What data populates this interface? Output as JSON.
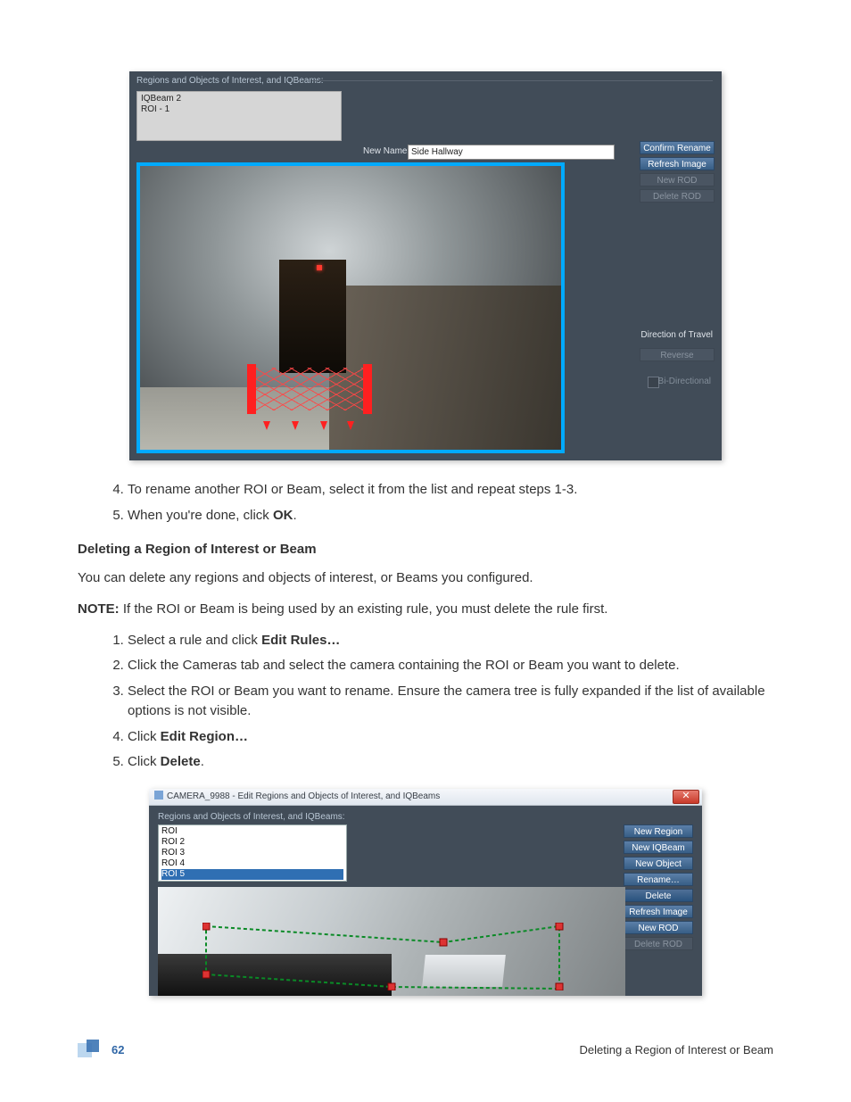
{
  "shot1": {
    "group_label": "Regions and Objects of Interest, and IQBeams:",
    "list_items": [
      "IQBeam 2",
      "ROI - 1"
    ],
    "new_name_label": "New Name:",
    "new_name_value": "Side Hallway",
    "buttons": {
      "confirm_rename": "Confirm Rename",
      "refresh_image": "Refresh Image",
      "new_rod": "New ROD",
      "delete_rod": "Delete ROD",
      "direction_label": "Direction of Travel",
      "reverse": "Reverse",
      "bidir_label": "Bi-Directional"
    }
  },
  "steps_top": {
    "s4_a": "To rename another ROI or Beam, select it from the list and repeat steps 1-3.",
    "s5_a": "When you're done, click ",
    "s5_b": "OK",
    "s5_c": "."
  },
  "heading": "Deleting a Region of Interest or Beam",
  "para1": "You can delete any regions and objects of interest, or Beams you configured.",
  "note_label": "NOTE:",
  "note_body": " If the ROI or Beam is being used by an existing rule, you must delete the rule first.",
  "steps_bottom": {
    "s1_a": "Select a rule and click ",
    "s1_b": "Edit Rules…",
    "s2": "Click the Cameras tab and select the camera containing the ROI or Beam you want to delete.",
    "s3": "Select the ROI or Beam you want to rename. Ensure the camera tree is fully expanded if the list of available options is not visible.",
    "s4_a": "Click ",
    "s4_b": "Edit Region…",
    "s5_a": "Click ",
    "s5_b": "Delete",
    "s5_c": "."
  },
  "shot2": {
    "title": "CAMERA_9988 - Edit Regions and Objects of Interest, and IQBeams",
    "group_label": "Regions and Objects of Interest, and IQBeams:",
    "list_items": [
      "ROI",
      "ROI 2",
      "ROI 3",
      "ROI 4",
      "ROI 5"
    ],
    "selected_index": 4,
    "buttons": {
      "new_region": "New Region",
      "new_iqbeam": "New IQBeam",
      "new_object": "New Object",
      "rename": "Rename…",
      "delete": "Delete",
      "refresh_image": "Refresh Image",
      "new_rod": "New ROD",
      "delete_rod": "Delete ROD"
    }
  },
  "footer": {
    "page_number": "62",
    "right": "Deleting a Region of Interest or Beam"
  }
}
